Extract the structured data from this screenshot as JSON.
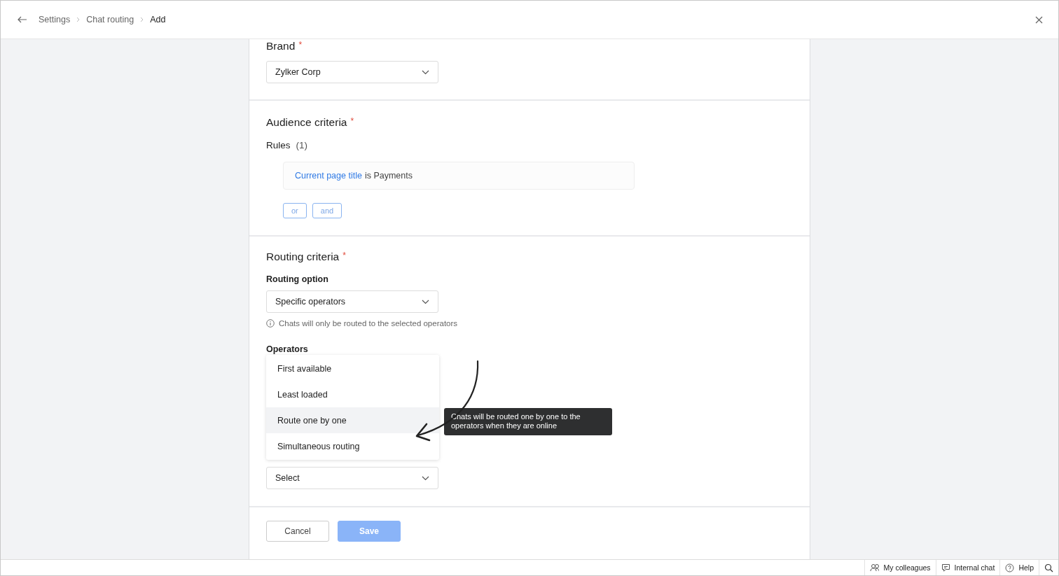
{
  "header": {
    "breadcrumbs": [
      {
        "label": "Settings",
        "current": false
      },
      {
        "label": "Chat routing",
        "current": false
      },
      {
        "label": "Add",
        "current": true
      }
    ]
  },
  "brand": {
    "title": "Brand",
    "required_mark": "*",
    "value": "Zylker Corp"
  },
  "audience": {
    "title": "Audience criteria",
    "required_mark": "*",
    "rules_label": "Rules",
    "rules_count": "(1)",
    "rules": [
      {
        "field": "Current page title",
        "condition": "is Payments"
      }
    ],
    "connectors": [
      "or",
      "and"
    ]
  },
  "routing": {
    "title": "Routing criteria",
    "required_mark": "*",
    "option_label": "Routing option",
    "option_value": "Specific operators",
    "hint": "Chats will only be routed to the selected operators",
    "operators_label": "Operators",
    "menu": [
      {
        "label": "First available",
        "selected": false
      },
      {
        "label": "Least loaded",
        "selected": false
      },
      {
        "label": "Route one by one",
        "selected": true
      },
      {
        "label": "Simultaneous routing",
        "selected": false
      }
    ],
    "tooltip": "Chats will be routed one by one to the operators when they are online",
    "operators_placeholder": "Select"
  },
  "footer": {
    "buttons": [
      {
        "label": "Cancel",
        "kind": "secondary",
        "disabled": false
      },
      {
        "label": "Save",
        "kind": "primary",
        "disabled": true
      }
    ]
  },
  "status_bar": [
    {
      "kind": "colleagues",
      "label": "My colleagues"
    },
    {
      "kind": "chat",
      "label": "Internal chat"
    },
    {
      "kind": "help",
      "label": "Help"
    },
    {
      "kind": "search"
    }
  ]
}
